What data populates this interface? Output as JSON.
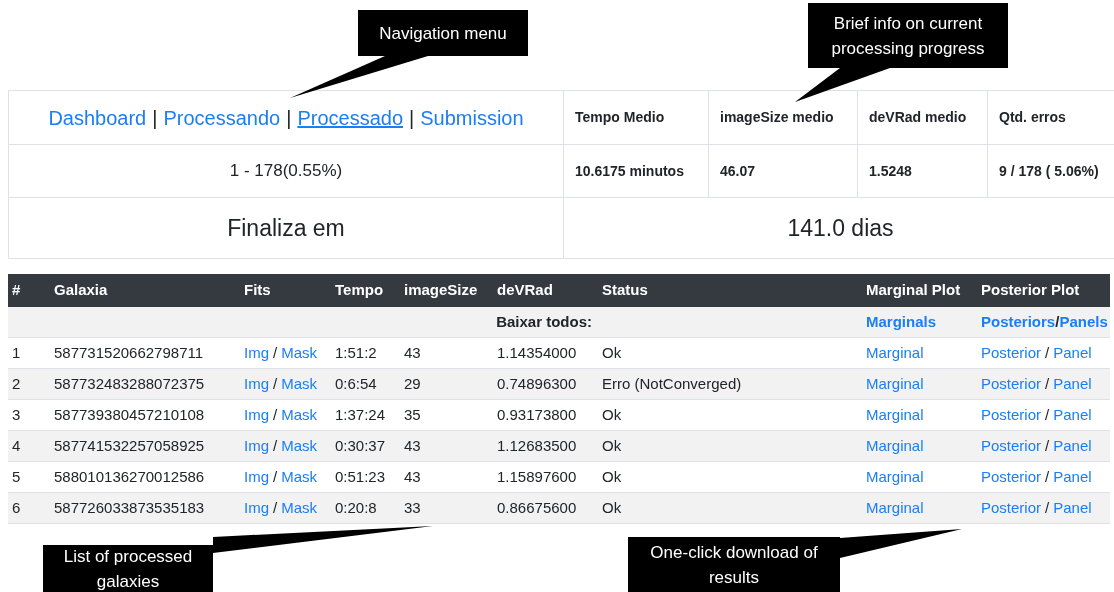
{
  "callouts": [
    {
      "text": "Navigation menu"
    },
    {
      "text": "Brief info on current processing progress"
    },
    {
      "text": "List of processed galaxies"
    },
    {
      "text": "One-click download of results"
    }
  ],
  "nav": {
    "items": [
      {
        "kind": "link",
        "label": "Dashboard",
        "selected": false
      },
      {
        "kind": "separator",
        "label": "|"
      },
      {
        "kind": "link",
        "label": "Processando",
        "selected": false
      },
      {
        "kind": "separator",
        "label": "|"
      },
      {
        "kind": "link",
        "label": "Processado",
        "selected": true
      },
      {
        "kind": "separator",
        "label": "|"
      },
      {
        "kind": "link",
        "label": "Submission",
        "selected": false
      }
    ]
  },
  "summary": {
    "progress": "1 - 178(0.55%)",
    "finish_label": "Finaliza em",
    "finish_value": "141.0 dias",
    "stats": [
      {
        "label": "Tempo Medio",
        "value": "10.6175 minutos"
      },
      {
        "label": "imageSize medio",
        "value": "46.07"
      },
      {
        "label": "deVRad medio",
        "value": "1.5248"
      },
      {
        "label": "Qtd. erros",
        "value": "9 / 178 ( 5.06%)"
      }
    ]
  },
  "table": {
    "columns": [
      "#",
      "Galaxia",
      "Fits",
      "Tempo",
      "imageSize",
      "deVRad",
      "Status",
      "Marginal Plot",
      "Posterior Plot"
    ],
    "download_all": {
      "label": "Baixar todos:",
      "marginals": "Marginals",
      "posteriors": "Posteriors",
      "sep": "/",
      "panels": "Panels"
    },
    "rows": [
      {
        "index": "1",
        "galaxy": "587731520662798711",
        "img": "Img",
        "fits_sep": "/",
        "mask": "Mask",
        "tempo": "1:51:2",
        "image_size": "43",
        "devrad": "1.14354000",
        "status": "Ok",
        "marginal": "Marginal",
        "posterior": "Posterior",
        "plot_sep": "/",
        "panel": "Panel"
      },
      {
        "index": "2",
        "galaxy": "587732483288072375",
        "img": "Img",
        "fits_sep": "/",
        "mask": "Mask",
        "tempo": "0:6:54",
        "image_size": "29",
        "devrad": "0.74896300",
        "status": "Erro (NotConverged)",
        "marginal": "Marginal",
        "posterior": "Posterior",
        "plot_sep": "/",
        "panel": "Panel"
      },
      {
        "index": "3",
        "galaxy": "587739380457210108",
        "img": "Img",
        "fits_sep": "/",
        "mask": "Mask",
        "tempo": "1:37:24",
        "image_size": "35",
        "devrad": "0.93173800",
        "status": "Ok",
        "marginal": "Marginal",
        "posterior": "Posterior",
        "plot_sep": "/",
        "panel": "Panel"
      },
      {
        "index": "4",
        "galaxy": "587741532257058925",
        "img": "Img",
        "fits_sep": "/",
        "mask": "Mask",
        "tempo": "0:30:37",
        "image_size": "43",
        "devrad": "1.12683500",
        "status": "Ok",
        "marginal": "Marginal",
        "posterior": "Posterior",
        "plot_sep": "/",
        "panel": "Panel"
      },
      {
        "index": "5",
        "galaxy": "588010136270012586",
        "img": "Img",
        "fits_sep": "/",
        "mask": "Mask",
        "tempo": "0:51:23",
        "image_size": "43",
        "devrad": "1.15897600",
        "status": "Ok",
        "marginal": "Marginal",
        "posterior": "Posterior",
        "plot_sep": "/",
        "panel": "Panel"
      },
      {
        "index": "6",
        "galaxy": "587726033873535183",
        "img": "Img",
        "fits_sep": "/",
        "mask": "Mask",
        "tempo": "0:20:8",
        "image_size": "33",
        "devrad": "0.86675600",
        "status": "Ok",
        "marginal": "Marginal",
        "posterior": "Posterior",
        "plot_sep": "/",
        "panel": "Panel"
      }
    ]
  }
}
